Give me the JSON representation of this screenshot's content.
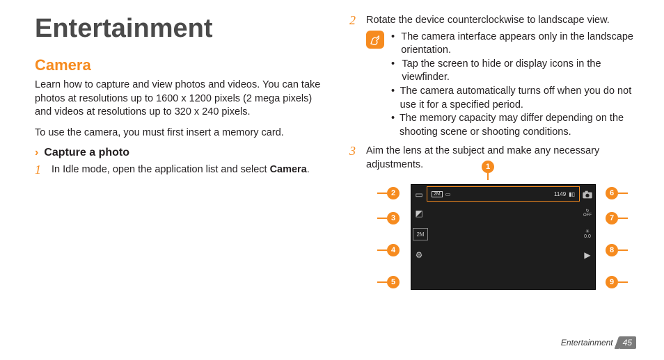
{
  "left": {
    "title": "Entertainment",
    "section": "Camera",
    "intro1": "Learn how to capture and view photos and videos. You can take photos at resolutions up to 1600 x 1200 pixels (2 mega pixels) and videos at resolutions up to 320 x 240 pixels.",
    "intro2": "To use the camera, you must first insert a memory card.",
    "subheading": "Capture a photo",
    "step1_prefix": "In Idle mode, open the application list and select ",
    "step1_bold": "Camera",
    "step1_suffix": "."
  },
  "right": {
    "step2": "Rotate the device counterclockwise to landscape view.",
    "notes": [
      "The camera interface appears only in the landscape orientation.",
      "Tap the screen to hide or display icons in the viewfinder.",
      "The camera automatically turns off when you do not use it for a specified period.",
      "The memory capacity may differ depending on the shooting scene or shooting conditions."
    ],
    "step3": "Aim the lens at the subject and make any necessary adjustments."
  },
  "diagram": {
    "callouts": [
      "1",
      "2",
      "3",
      "4",
      "5",
      "6",
      "7",
      "8",
      "9"
    ],
    "topbar_left": "2M",
    "topbar_count": "1149",
    "left_icons": [
      "rect-icon",
      "diag-icon",
      "res-2m-icon",
      "gear-icon"
    ],
    "right_icons": [
      "camera-icon",
      "timer-off-icon",
      "exposure-0-icon",
      "play-icon"
    ],
    "exposure_label": "0.0",
    "timer_label": "OFF"
  },
  "footer": {
    "section": "Entertainment",
    "page": "45"
  }
}
